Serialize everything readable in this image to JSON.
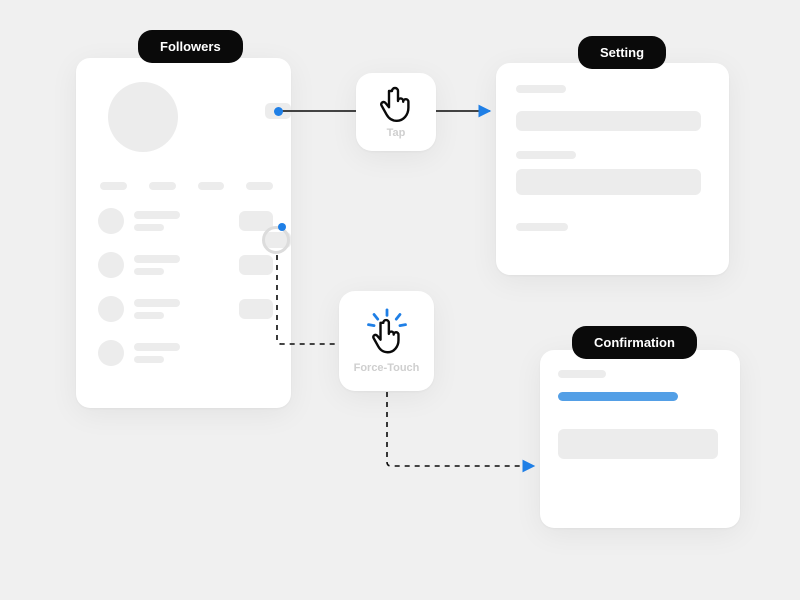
{
  "labels": {
    "followers": "Followers",
    "setting": "Setting",
    "confirmation": "Confirmation"
  },
  "gestures": {
    "tap": "Tap",
    "force_touch": "Force-Touch"
  }
}
